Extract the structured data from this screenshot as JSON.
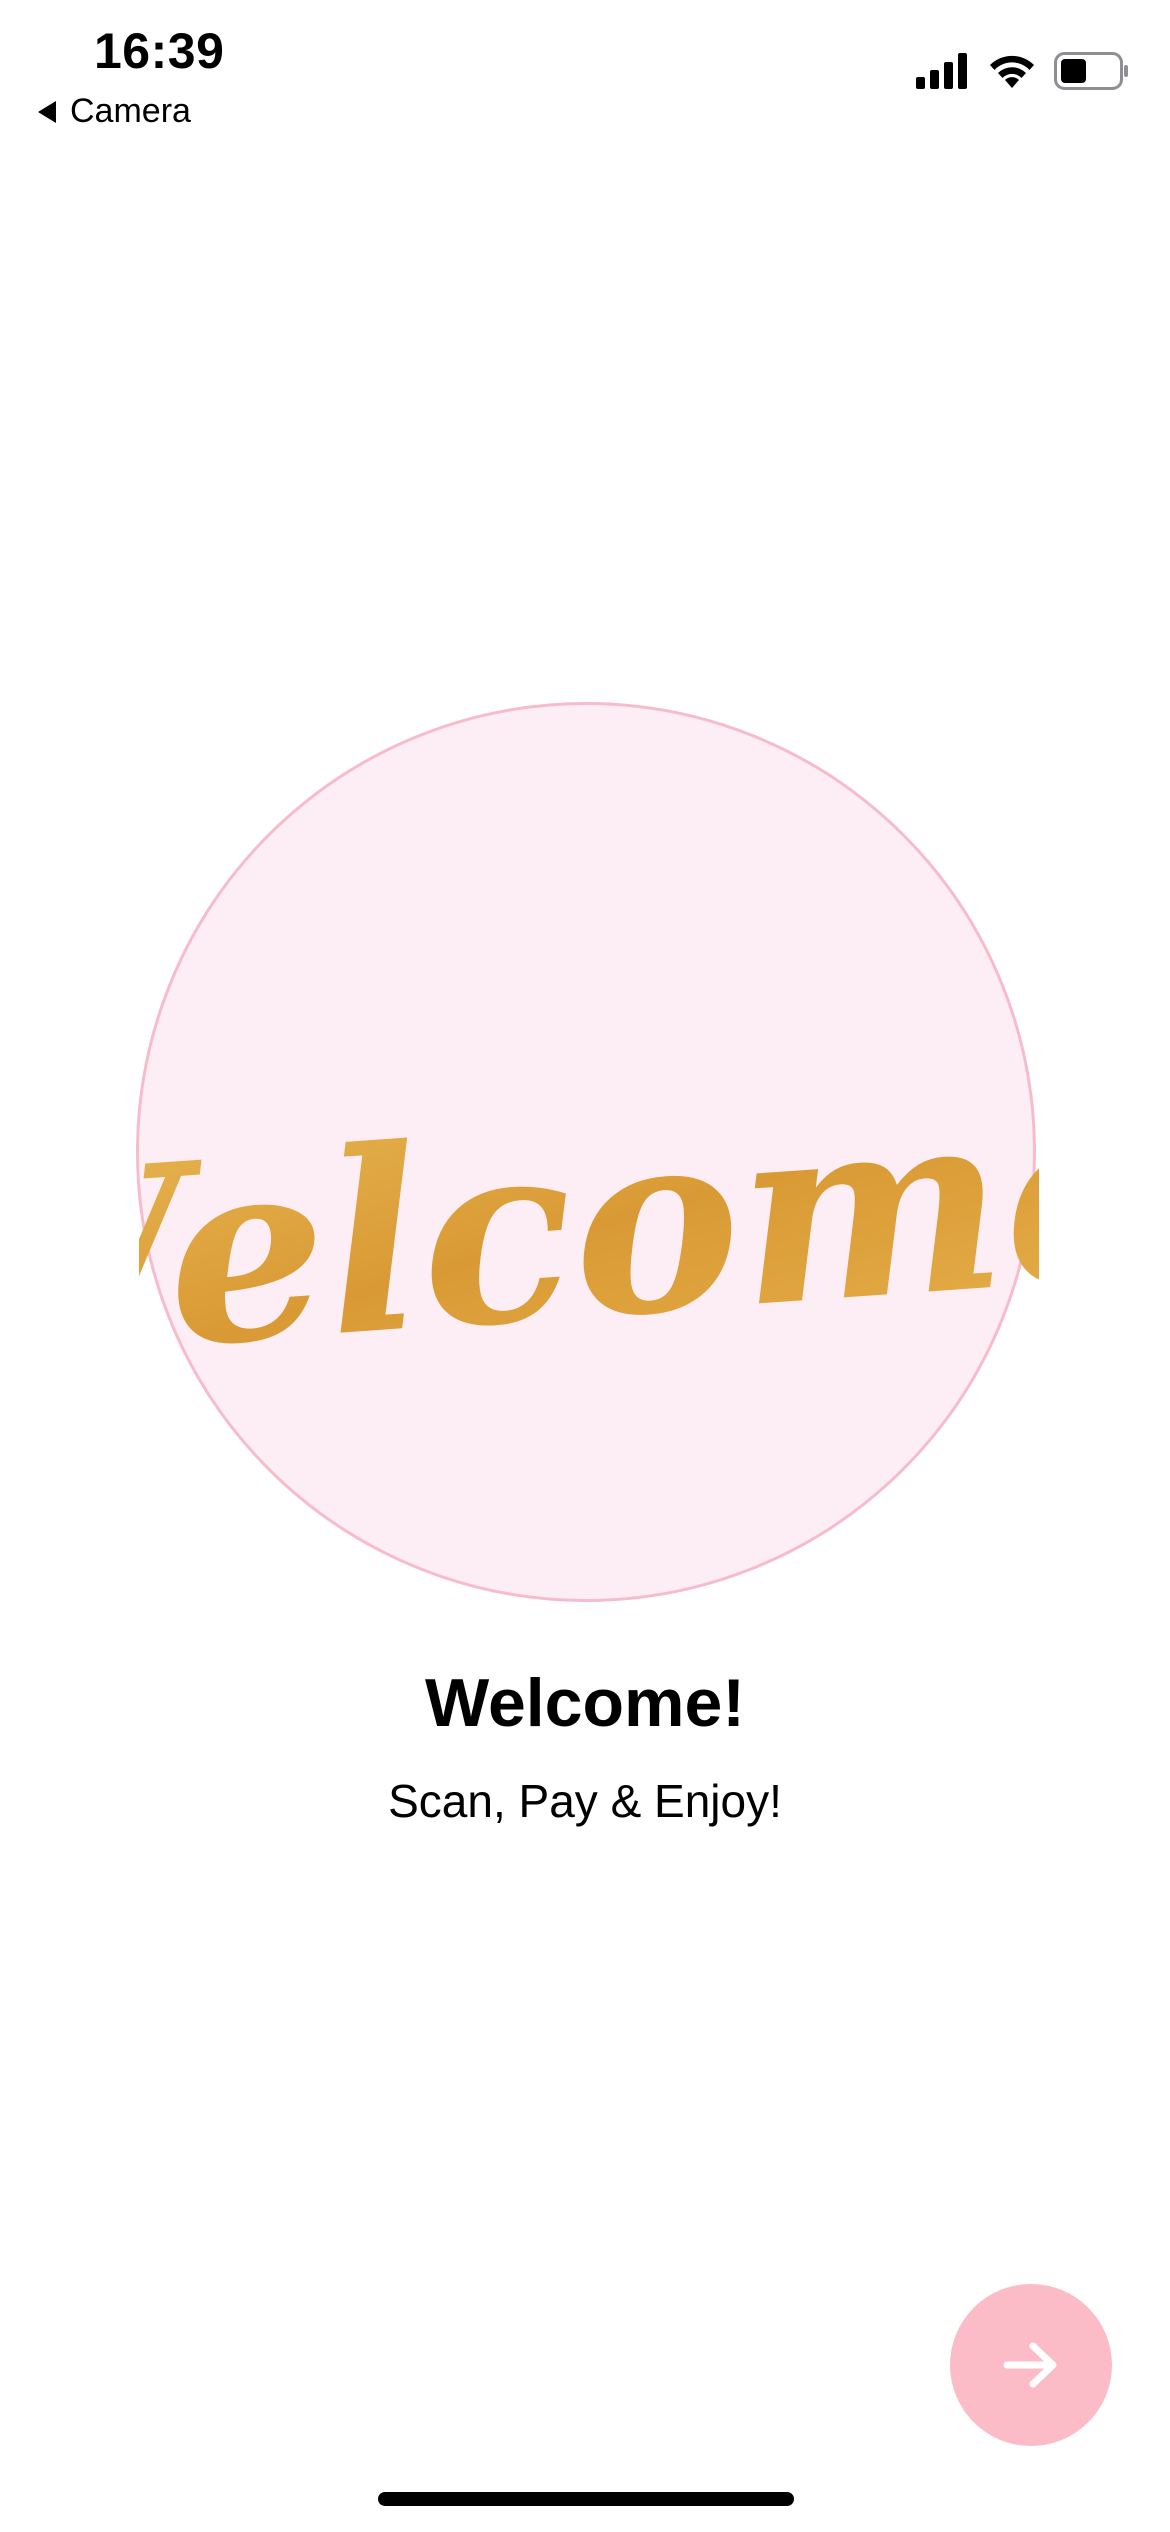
{
  "status_bar": {
    "time": "16:39",
    "back_app_label": "Camera",
    "icons": [
      "signal-icon",
      "wifi-icon",
      "battery-icon"
    ]
  },
  "hero": {
    "script_text": "Welcome!",
    "circle_fill": "#fdeef5",
    "circle_border": "#f7bccb",
    "lettering_color": "#dda43a"
  },
  "content": {
    "title": "Welcome!",
    "subtitle": "Scan, Pay & Enjoy!"
  },
  "next_button": {
    "icon": "arrow-right-icon",
    "color": "#fbbcc7"
  }
}
